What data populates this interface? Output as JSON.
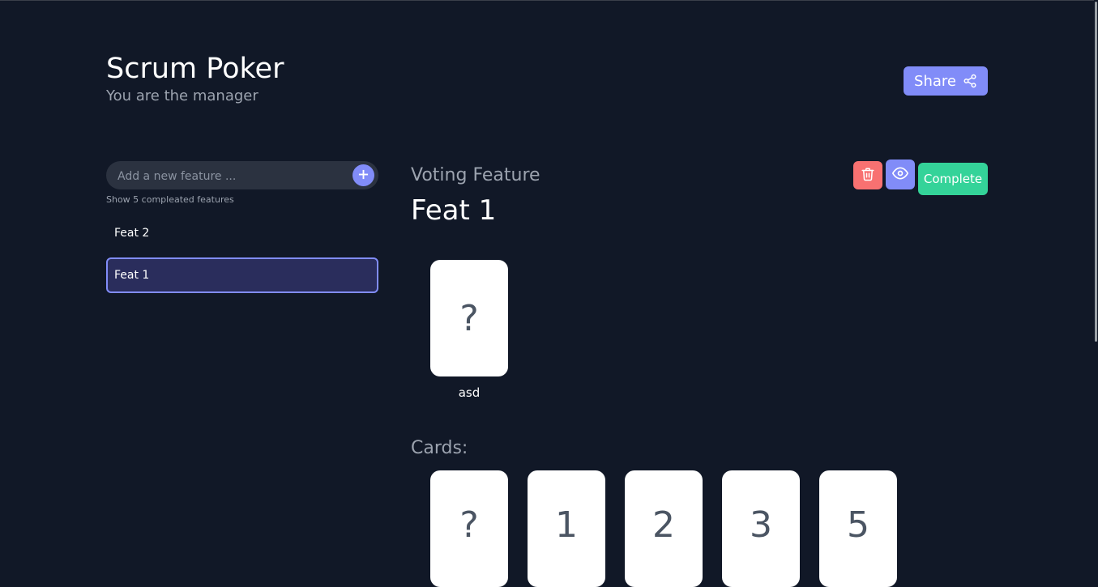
{
  "header": {
    "title": "Scrum Poker",
    "subtitle": "You are the manager",
    "share_label": "Share"
  },
  "sidebar": {
    "input_placeholder": "Add a new feature ...",
    "show_completed": "Show 5 compleated features",
    "features": [
      {
        "label": "Feat 2",
        "selected": false
      },
      {
        "label": "Feat 1",
        "selected": true
      }
    ]
  },
  "main": {
    "section_label": "Voting Feature",
    "feature_title": "Feat 1",
    "complete_label": "Complete",
    "votes": [
      {
        "card": "?",
        "voter": "asd"
      }
    ],
    "cards_label": "Cards:",
    "cards": [
      "?",
      "1",
      "2",
      "3",
      "5"
    ]
  },
  "colors": {
    "background": "#111827",
    "accent": "#818cf8",
    "danger": "#f87171",
    "success": "#34d399",
    "selected_bg": "#2a2d5c"
  },
  "icons": {
    "share": "share-icon",
    "add": "plus-icon",
    "delete": "trash-icon",
    "reveal": "eye-icon"
  }
}
